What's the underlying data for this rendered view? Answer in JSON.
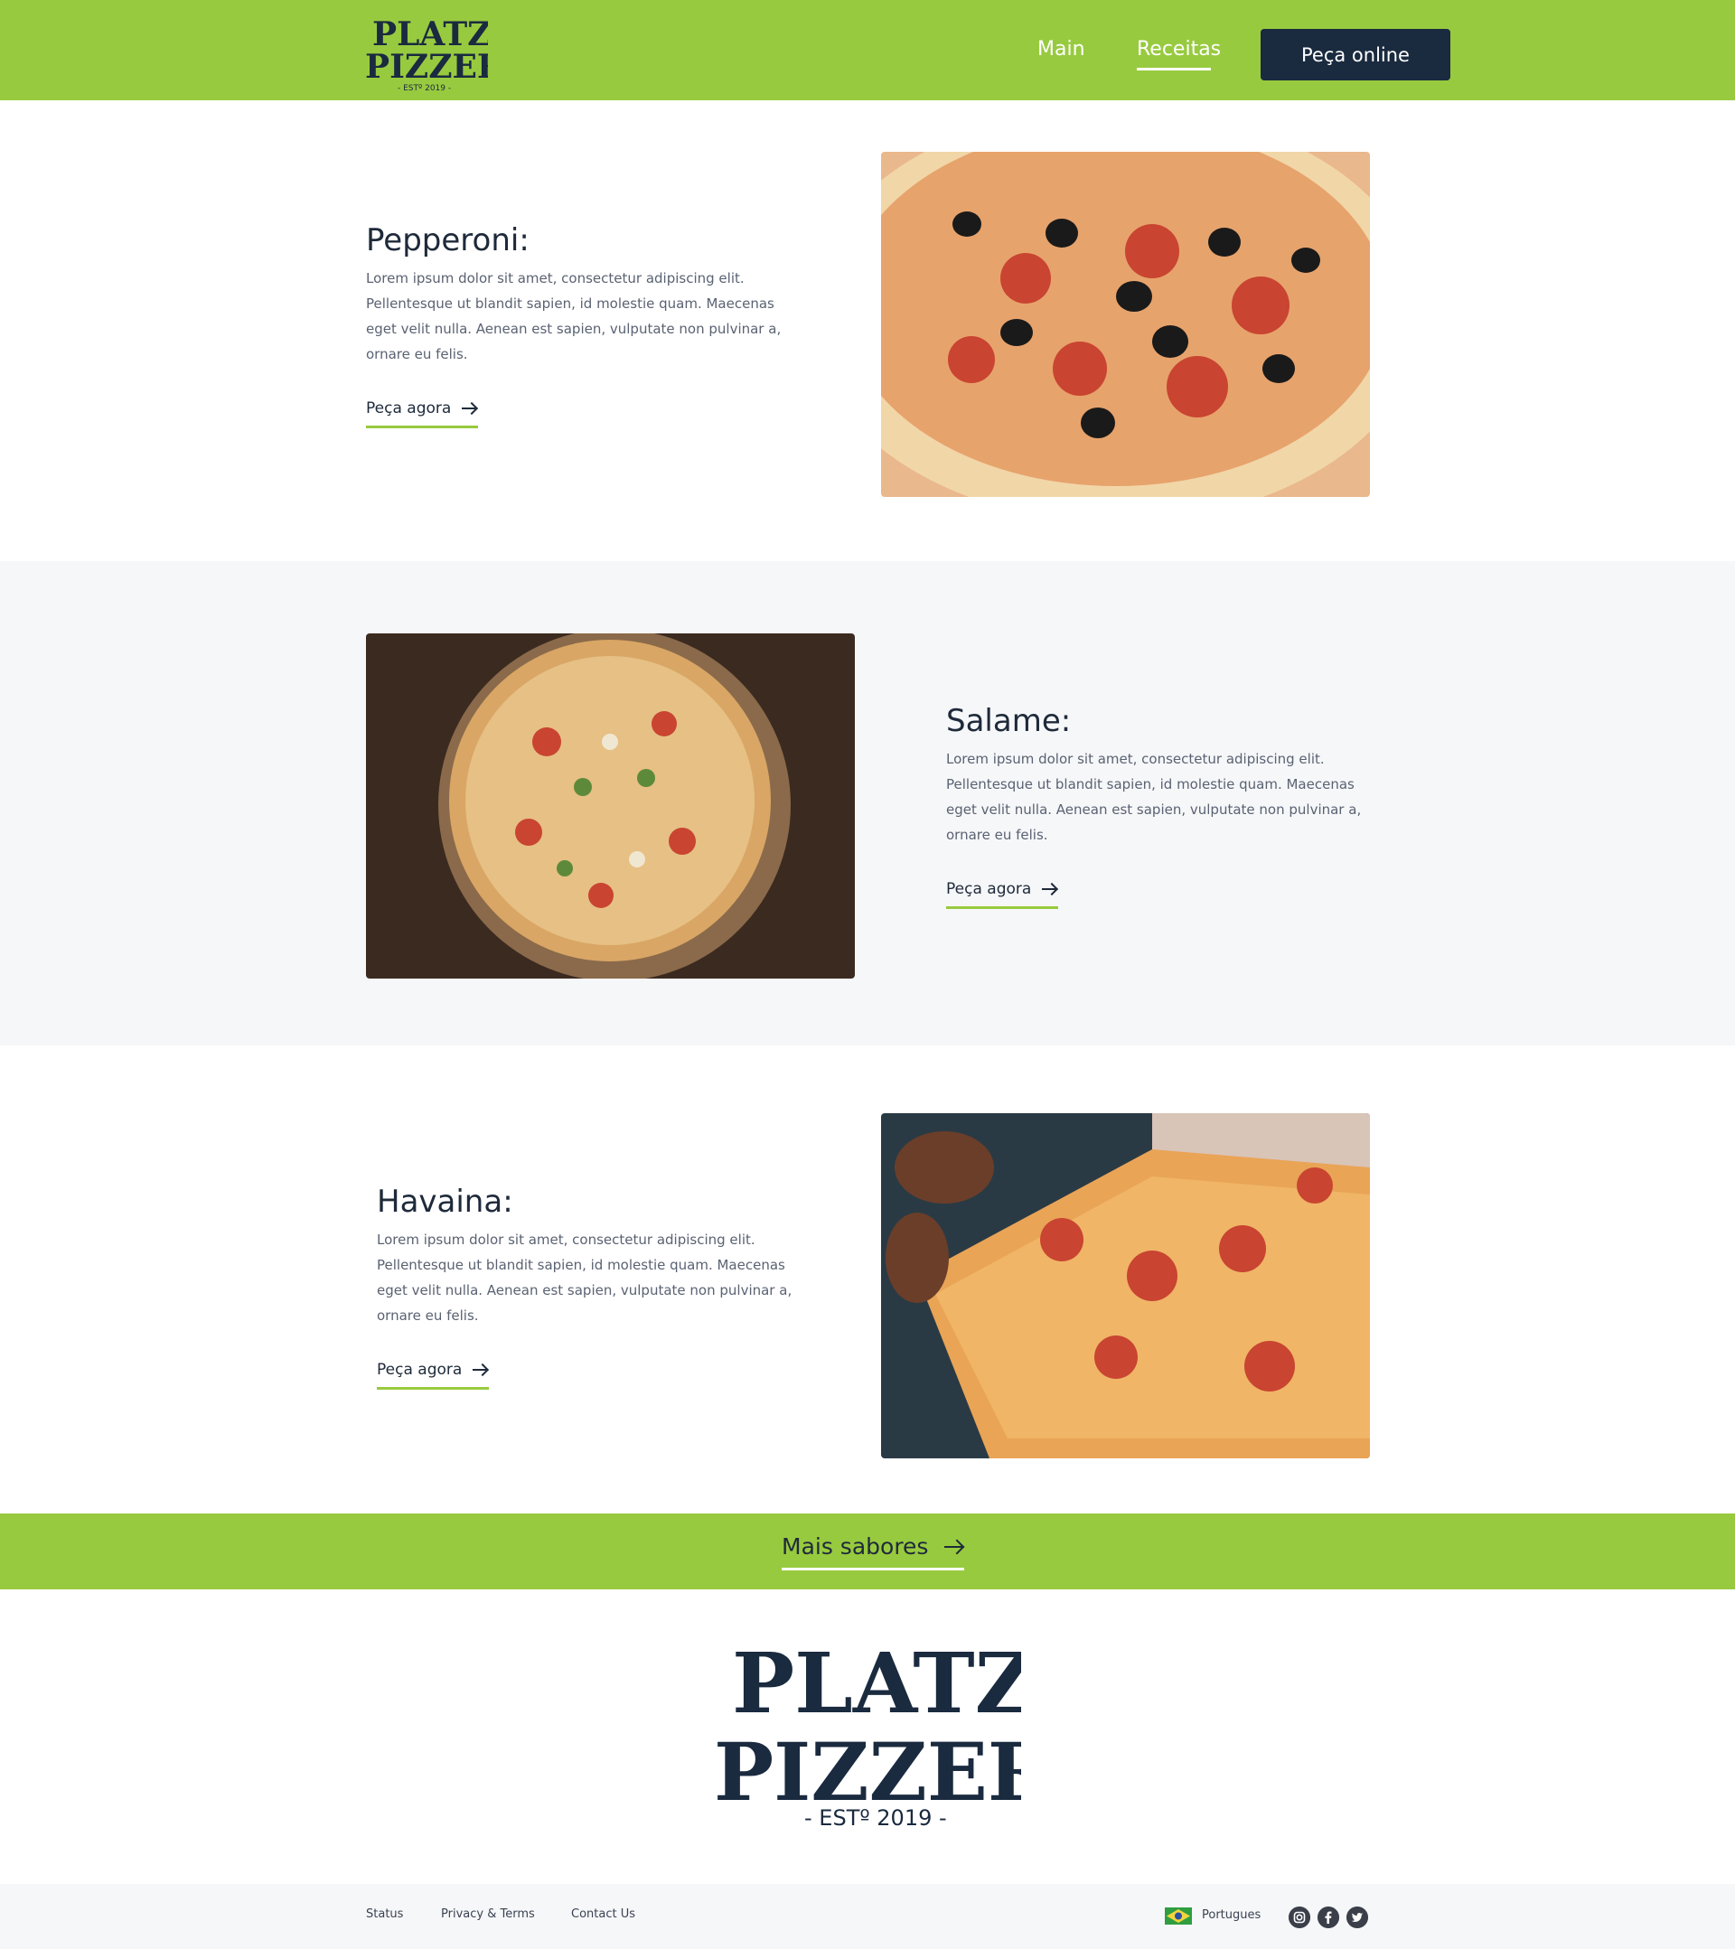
{
  "header": {
    "nav": [
      {
        "label": "Main"
      },
      {
        "label": "Receitas"
      }
    ],
    "cta_label": "Peça online"
  },
  "logo": {
    "line1": "PLATZI",
    "line2": "PIZZERIA",
    "tagline": "- ESTº 2019 -"
  },
  "recipes": [
    {
      "title": "Pepperoni:",
      "text": "Lorem ipsum dolor sit amet, consectetur adipiscing elit. Pellentesque ut blandit sapien, id molestie quam. Maecenas eget velit nulla. Aenean est sapien, vulputate non pulvinar a, ornare eu felis.",
      "cta": "Peça agora"
    },
    {
      "title": "Salame:",
      "text": "Lorem ipsum dolor sit amet, consectetur adipiscing elit. Pellentesque ut blandit sapien, id molestie quam. Maecenas eget velit nulla. Aenean est sapien, vulputate non pulvinar a, ornare eu felis.",
      "cta": "Peça agora"
    },
    {
      "title": "Havaina:",
      "text": "Lorem ipsum dolor sit amet, consectetur adipiscing elit. Pellentesque ut blandit sapien, id molestie quam. Maecenas eget velit nulla. Aenean est sapien, vulputate non pulvinar a, ornare eu felis.",
      "cta": "Peça agora"
    }
  ],
  "more": {
    "label": "Mais sabores"
  },
  "footer": {
    "links": [
      {
        "label": "Status"
      },
      {
        "label": "Privacy & Terms"
      },
      {
        "label": "Contact Us"
      }
    ],
    "language": "Portugues",
    "social": [
      "instagram-icon",
      "facebook-icon",
      "twitter-icon"
    ]
  },
  "colors": {
    "brand_green": "#98ca3f",
    "navy": "#1a2a3f",
    "light_bg": "#f6f7f9"
  }
}
